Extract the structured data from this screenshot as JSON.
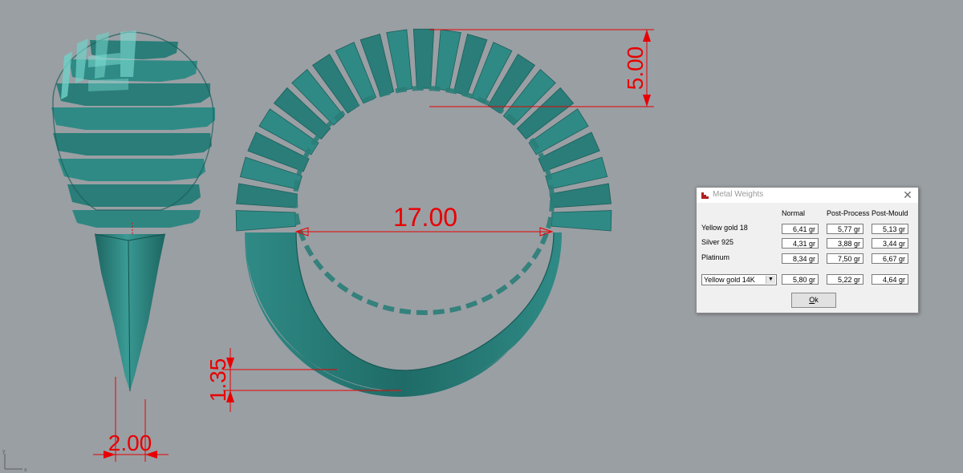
{
  "dimensions": {
    "shank_width": "2.00",
    "inner_diameter": "17.00",
    "top_height": "5.00",
    "band_thickness": "1.35"
  },
  "axis_indicator": {
    "x": "x",
    "y": "y"
  },
  "colors": {
    "model": "#2b7d79",
    "dimension": "#e80000",
    "background": "#9a9fa4"
  },
  "metal_weights_dialog": {
    "title": "Metal Weights",
    "close_icon": "close-icon",
    "columns": [
      "Normal",
      "Post-Process",
      "Post-Mould"
    ],
    "rows": [
      {
        "label": "Yellow gold 18",
        "values": [
          "6,41 gr",
          "5,77 gr",
          "5,13 gr"
        ]
      },
      {
        "label": "Silver 925",
        "values": [
          "4,31 gr",
          "3,88 gr",
          "3,44 gr"
        ]
      },
      {
        "label": "Platinum",
        "values": [
          "8,34 gr",
          "7,50 gr",
          "6,67 gr"
        ]
      }
    ],
    "custom_metal": {
      "selected": "Yellow gold 14K",
      "values": [
        "5,80 gr",
        "5,22 gr",
        "4,64 gr"
      ]
    },
    "ok_label_u": "O",
    "ok_label_rest": "k"
  }
}
